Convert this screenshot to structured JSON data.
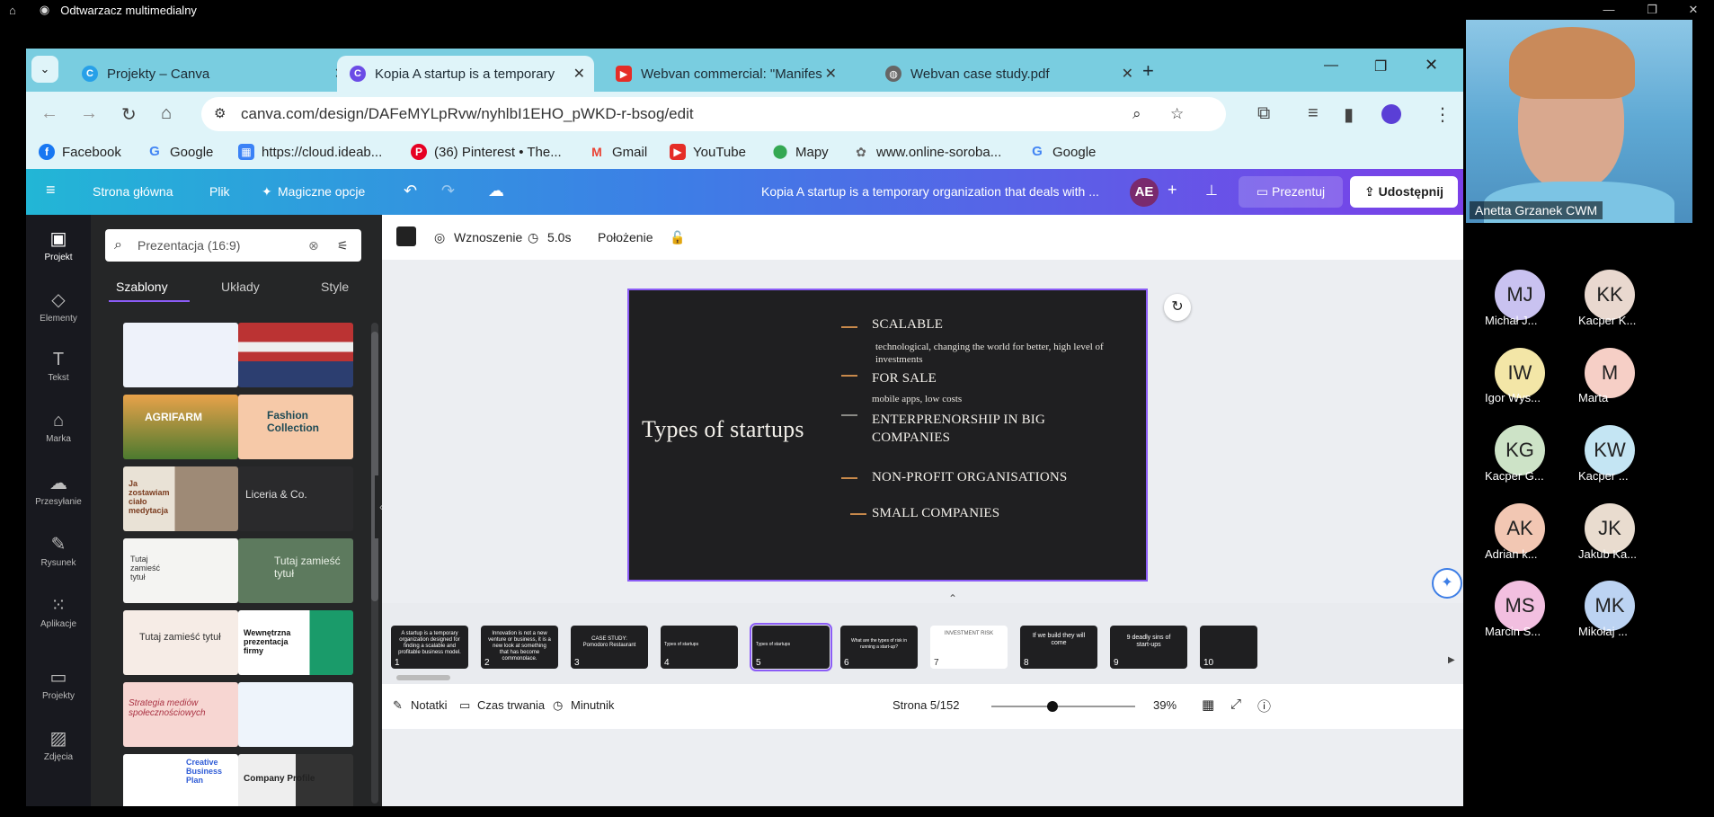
{
  "window": {
    "title": "Odtwarzacz multimedialny"
  },
  "tabs": [
    {
      "label": "Projekty – Canva",
      "icon": "canva-icon",
      "color": "#27a0e8",
      "active": false
    },
    {
      "label": "Kopia A startup is a temporary",
      "icon": "canva-icon",
      "color": "#6b4ce6",
      "active": true
    },
    {
      "label": "Webvan commercial: \"Manifes",
      "icon": "youtube-icon",
      "color": "#e52d27",
      "active": false
    },
    {
      "label": "Webvan case study.pdf",
      "icon": "globe-icon",
      "color": "#666666",
      "active": false
    }
  ],
  "address": {
    "url": "canva.com/design/DAFeMYLpRvw/nyhlbI1EHO_pWKD-r-bsog/edit"
  },
  "bookmarks": [
    "Facebook",
    "Google",
    "https://cloud.ideab...",
    "(36) Pinterest • The...",
    "Gmail",
    "YouTube",
    "Mapy",
    "www.online-soroba...",
    "Google"
  ],
  "canva": {
    "menu": [
      "Strona główna",
      "Plik",
      "Magiczne opcje"
    ],
    "doc_title": "Kopia A startup is a temporary organization that deals with ...",
    "avatar": "AE",
    "present": "Prezentuj",
    "share": "Udostępnij"
  },
  "rail": [
    "Projekt",
    "Elementy",
    "Tekst",
    "Marka",
    "Przesyłanie",
    "Rysunek",
    "Aplikacje",
    "Projekty",
    "Zdjęcia"
  ],
  "panel": {
    "search": "Prezentacja (16:9)",
    "tabs": [
      "Szablony",
      "Układy",
      "Style"
    ],
    "thumbs": [
      "",
      "",
      "AGRIFARM",
      "Fashion Collection",
      "Ja zostawiam ciało medytacja",
      "Liceria & Co.",
      "Tutaj zamieść tytuł",
      "Tutaj zamieść tytuł",
      "Tutaj zamieść tytuł",
      "Wewnętrzna prezentacja firmy",
      "Strategia mediów społecznościowych",
      "",
      "Creative Business Plan",
      "Company Profile"
    ]
  },
  "editor_tools": {
    "anim": "Wznoszenie",
    "time": "5.0s",
    "pos": "Położenie"
  },
  "slide": {
    "title": "Types of startups",
    "items": [
      {
        "head": "SCALABLE",
        "sub": "technological, changing the world for better, high level of investments"
      },
      {
        "head": "FOR SALE",
        "sub": "mobile apps, low costs"
      },
      {
        "head": "ENTERPRENORSHIP IN BIG COMPANIES",
        "sub": ""
      },
      {
        "head": "NON-PROFIT ORGANISATIONS",
        "sub": ""
      },
      {
        "head": "SMALL COMPANIES",
        "sub": ""
      }
    ]
  },
  "strip": [
    {
      "n": "1",
      "t": "A startup is a temporary organization designed for finding a scalable and profitable business model."
    },
    {
      "n": "2",
      "t": "Innovation is not a new venture or business, it is a new look at something that has become commonplace."
    },
    {
      "n": "3",
      "t": "CASE STUDY: Pomodoro Restaurant"
    },
    {
      "n": "4",
      "t": "Types of startups"
    },
    {
      "n": "5",
      "t": "Types of startups"
    },
    {
      "n": "6",
      "t": "What are the types of risk in running a start-up?"
    },
    {
      "n": "7",
      "t": "INVESTMENT RISK"
    },
    {
      "n": "8",
      "t": "If we build they will come"
    },
    {
      "n": "9",
      "t": "9 deadly sins of start-ups"
    },
    {
      "n": "10",
      "t": ""
    }
  ],
  "bottom": {
    "notes": "Notatki",
    "duration": "Czas trwania",
    "timer": "Minutnik",
    "page": "Strona 5/152",
    "zoom": "39%"
  },
  "call": {
    "presenter": "Anetta Grzanek CWM",
    "participants": [
      {
        "i": "MJ",
        "name": "Michał J...",
        "c": "#c9c2f0"
      },
      {
        "i": "KK",
        "name": "Kacper K...",
        "c": "#e9d8cf"
      },
      {
        "i": "IW",
        "name": "Igor Wys...",
        "c": "#f3e6a7"
      },
      {
        "i": "M",
        "name": "Marta",
        "c": "#f6cfc6"
      },
      {
        "i": "KG",
        "name": "Kacper G...",
        "c": "#cde3c7"
      },
      {
        "i": "KW",
        "name": "Kacper ...",
        "c": "#c4e5f3"
      },
      {
        "i": "AK",
        "name": "Adrian k...",
        "c": "#f2c7b3"
      },
      {
        "i": "JK",
        "name": "Jakub Ka...",
        "c": "#e9dccf"
      },
      {
        "i": "MS",
        "name": "Marcin S...",
        "c": "#f2bfe0"
      },
      {
        "i": "MK",
        "name": "Mikołaj ...",
        "c": "#bcd3f2"
      }
    ]
  }
}
